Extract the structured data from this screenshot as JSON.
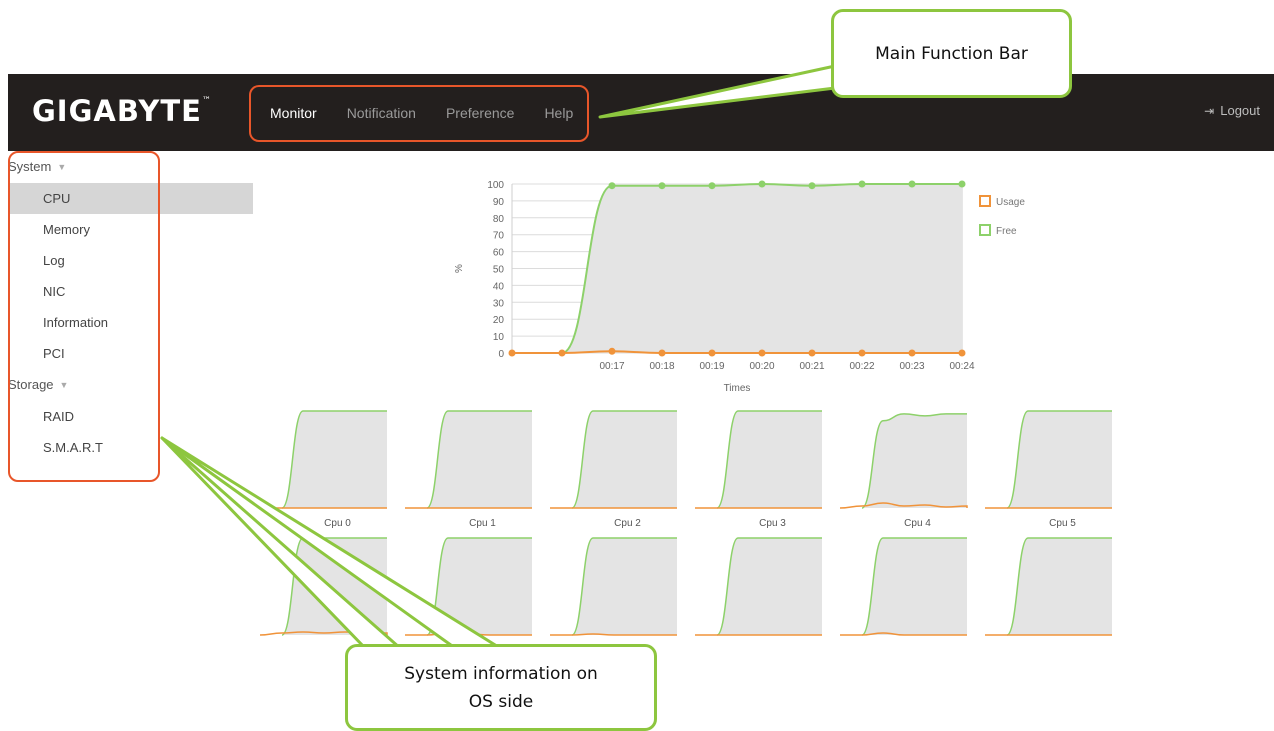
{
  "brand": {
    "name": "GIGABYTE",
    "tm": "™"
  },
  "nav": {
    "items": [
      {
        "label": "Monitor",
        "active": true
      },
      {
        "label": "Notification",
        "active": false
      },
      {
        "label": "Preference",
        "active": false
      },
      {
        "label": "Help",
        "active": false
      }
    ],
    "logout_label": "Logout",
    "logout_icon": "sign-out-icon"
  },
  "sidebar": {
    "groups": [
      {
        "label": "System",
        "items": [
          "CPU",
          "Memory",
          "Log",
          "NIC",
          "Information",
          "PCI"
        ]
      },
      {
        "label": "Storage",
        "items": [
          "RAID",
          "S.M.A.R.T"
        ]
      }
    ],
    "selected": "CPU"
  },
  "callouts": {
    "top": "Main Function Bar",
    "bottom_line1": "System information on",
    "bottom_line2": "OS side"
  },
  "colors": {
    "usage": "#f0933a",
    "free": "#8dd16a",
    "topbar": "#231f1e",
    "annotation_red": "#e8562a",
    "callout_green": "#8dc63f"
  },
  "chart_data": [
    {
      "type": "line",
      "x": [
        "",
        "",
        "00:17",
        "00:18",
        "00:19",
        "00:20",
        "00:21",
        "00:22",
        "00:23",
        "00:24"
      ],
      "series": [
        {
          "name": "Usage",
          "values": [
            0,
            0,
            1,
            0,
            0,
            0,
            0,
            0,
            0,
            0
          ]
        },
        {
          "name": "Free",
          "values": [
            0,
            0,
            99,
            99,
            99,
            100,
            99,
            100,
            100,
            100
          ]
        }
      ],
      "xlabel": "Times",
      "ylabel": "%",
      "ylim": [
        0,
        100
      ],
      "yticks": [
        0,
        10,
        20,
        30,
        40,
        50,
        60,
        70,
        80,
        90,
        100
      ],
      "grid": true,
      "legend": "right"
    },
    {
      "type": "area",
      "cpus": [
        {
          "label": "Cpu 0",
          "free": [
            0,
            100,
            100,
            100,
            100,
            100
          ],
          "usage": [
            0,
            0,
            0,
            0,
            0,
            0
          ]
        },
        {
          "label": "Cpu 1",
          "free": [
            0,
            100,
            100,
            100,
            100,
            100
          ],
          "usage": [
            0,
            0,
            0,
            0,
            0,
            0
          ]
        },
        {
          "label": "Cpu 2",
          "free": [
            0,
            100,
            100,
            100,
            100,
            100
          ],
          "usage": [
            0,
            0,
            0,
            0,
            0,
            0
          ]
        },
        {
          "label": "Cpu 3",
          "free": [
            0,
            100,
            100,
            100,
            100,
            100
          ],
          "usage": [
            0,
            0,
            0,
            0,
            0,
            0
          ]
        },
        {
          "label": "Cpu 4",
          "free": [
            0,
            90,
            97,
            95,
            97,
            97
          ],
          "usage": [
            2,
            5,
            2,
            3,
            1,
            2
          ]
        },
        {
          "label": "Cpu 5",
          "free": [
            0,
            100,
            100,
            100,
            100,
            100
          ],
          "usage": [
            0,
            0,
            0,
            0,
            0,
            0
          ]
        },
        {
          "label": "",
          "free": [
            0,
            100,
            100,
            100,
            100,
            100
          ],
          "usage": [
            2,
            3,
            2,
            3,
            2,
            2
          ]
        },
        {
          "label": "",
          "free": [
            0,
            100,
            100,
            100,
            100,
            100
          ],
          "usage": [
            0,
            2,
            1,
            0,
            0,
            0
          ]
        },
        {
          "label": "",
          "free": [
            0,
            100,
            100,
            100,
            100,
            100
          ],
          "usage": [
            0,
            1,
            0,
            0,
            0,
            0
          ]
        },
        {
          "label": "",
          "free": [
            0,
            100,
            100,
            100,
            100,
            100
          ],
          "usage": [
            0,
            0,
            0,
            0,
            0,
            0
          ]
        },
        {
          "label": "",
          "free": [
            0,
            100,
            100,
            100,
            100,
            100
          ],
          "usage": [
            0,
            2,
            0,
            0,
            0,
            0
          ]
        },
        {
          "label": "",
          "free": [
            0,
            100,
            100,
            100,
            100,
            100
          ],
          "usage": [
            0,
            0,
            0,
            0,
            0,
            0
          ]
        }
      ]
    }
  ]
}
